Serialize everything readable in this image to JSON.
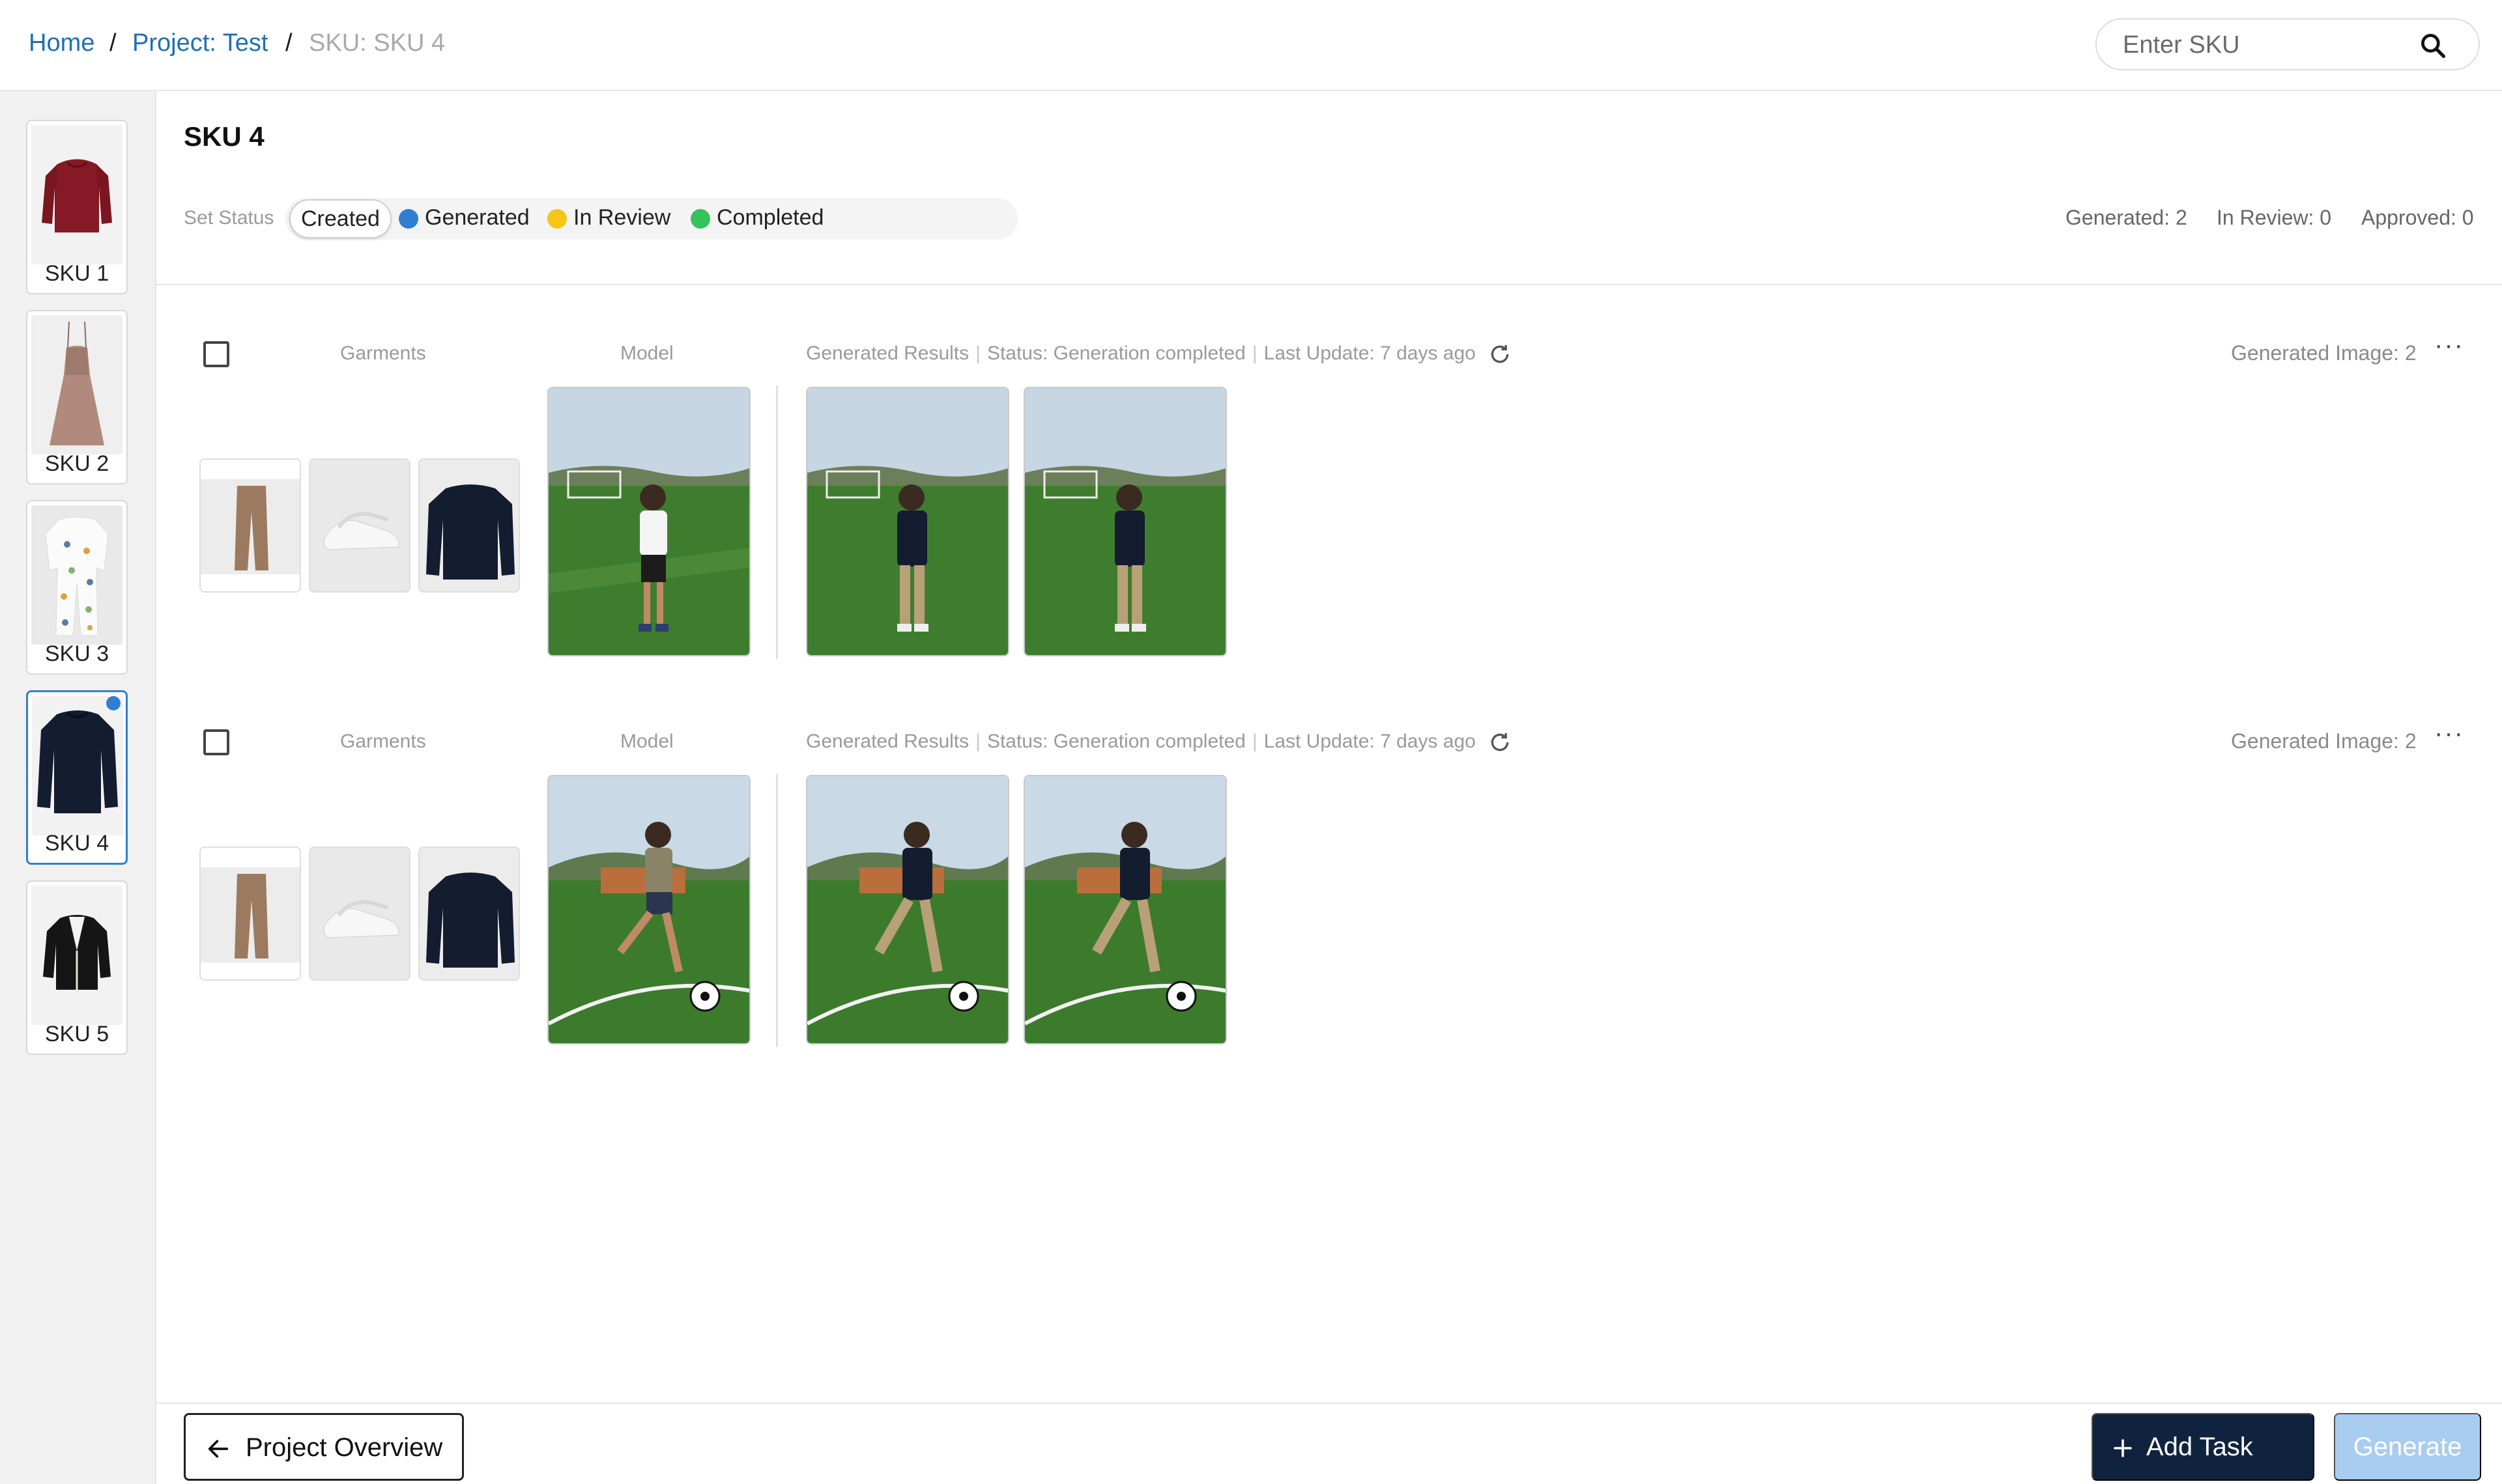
{
  "breadcrumb": {
    "home": "Home",
    "project": "Project: Test",
    "current": "SKU: SKU 4",
    "separator": "/"
  },
  "search": {
    "placeholder": "Enter SKU",
    "value": ""
  },
  "sidebar": {
    "items": [
      {
        "label": "SKU 1",
        "icon": "red-sweater-icon",
        "selected": false
      },
      {
        "label": "SKU 2",
        "icon": "dress-icon",
        "selected": false
      },
      {
        "label": "SKU 3",
        "icon": "sleepsuit-icon",
        "selected": false
      },
      {
        "label": "SKU 4",
        "icon": "navy-sweater-icon",
        "selected": true
      },
      {
        "label": "SKU 5",
        "icon": "cardigan-icon",
        "selected": false
      }
    ]
  },
  "main": {
    "title": "SKU 4",
    "set_status_label": "Set Status",
    "statuses": [
      {
        "label": "Created",
        "color": "",
        "active": true
      },
      {
        "label": "Generated",
        "color": "#2e7fd1",
        "active": false
      },
      {
        "label": "In Review",
        "color": "#f5c518",
        "active": false
      },
      {
        "label": "Completed",
        "color": "#34c25b",
        "active": false
      }
    ],
    "counts": {
      "generated": "Generated: 2",
      "in_review": "In Review: 0",
      "approved": "Approved: 0"
    }
  },
  "tasks": [
    {
      "garments_label": "Garments",
      "model_label": "Model",
      "results_label": "Generated Results",
      "status": "Status: Generation completed",
      "last_update": "Last Update: 7 days ago",
      "generated_count": "Generated Image: 2",
      "more": "···"
    },
    {
      "garments_label": "Garments",
      "model_label": "Model",
      "results_label": "Generated Results",
      "status": "Status: Generation completed",
      "last_update": "Last Update: 7 days ago",
      "generated_count": "Generated Image: 2",
      "more": "···"
    }
  ],
  "footer": {
    "overview": "Project Overview",
    "add_task": "Add Task",
    "generate": "Generate"
  },
  "colors": {
    "link": "#1f6fb5",
    "accent": "#2e7fd1",
    "dark_button": "#10233e",
    "disabled_button": "#a8cdf0"
  }
}
